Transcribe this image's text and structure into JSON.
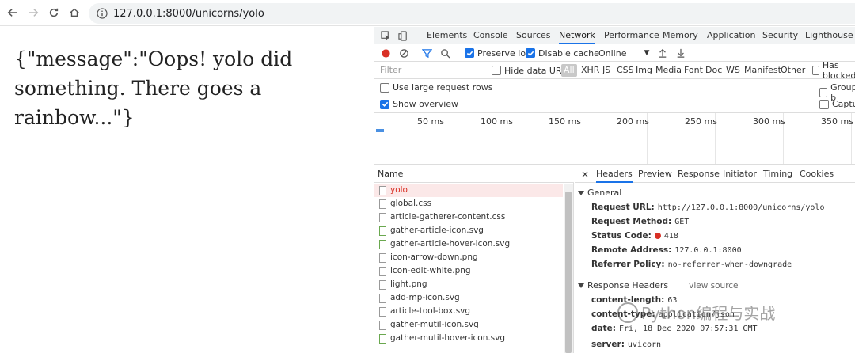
{
  "browser": {
    "url": "127.0.0.1:8000/unicorns/yolo"
  },
  "page": {
    "body_text": "{\"message\":\"Oops! yolo did something. There goes a rainbow...\"}"
  },
  "devtools": {
    "tabs": [
      "Elements",
      "Console",
      "Sources",
      "Network",
      "Performance",
      "Memory",
      "Application",
      "Security",
      "Lighthouse"
    ],
    "active_tab": "Network",
    "toolbar": {
      "preserve_log": "Preserve log",
      "disable_cache": "Disable cache",
      "throttle": "Online"
    },
    "filter": {
      "placeholder": "Filter",
      "hide_data_urls": "Hide data URLs",
      "types": [
        "All",
        "XHR",
        "JS",
        "CSS",
        "Img",
        "Media",
        "Font",
        "Doc",
        "WS",
        "Manifest",
        "Other"
      ],
      "has_blocked": "Has blocked"
    },
    "options": {
      "large_rows": "Use large request rows",
      "show_overview": "Show overview",
      "group_by": "Group b",
      "capture": "Captur"
    },
    "timeline_ticks": [
      "50 ms",
      "100 ms",
      "150 ms",
      "200 ms",
      "250 ms",
      "300 ms",
      "350 ms"
    ],
    "requests": {
      "header": "Name",
      "items": [
        "yolo",
        "global.css",
        "article-gatherer-content.css",
        "gather-article-icon.svg",
        "gather-article-hover-icon.svg",
        "icon-arrow-down.png",
        "icon-edit-white.png",
        "light.png",
        "add-mp-icon.svg",
        "article-tool-box.svg",
        "gather-mutil-icon.svg",
        "gather-mutil-hover-icon.svg"
      ]
    },
    "detail": {
      "close": "×",
      "tabs": [
        "Headers",
        "Preview",
        "Response",
        "Initiator",
        "Timing",
        "Cookies"
      ],
      "general_label": "General",
      "general": {
        "request_url_k": "Request URL:",
        "request_url_v": "http://127.0.0.1:8000/unicorns/yolo",
        "method_k": "Request Method:",
        "method_v": "GET",
        "status_k": "Status Code:",
        "status_v": "418",
        "remote_k": "Remote Address:",
        "remote_v": "127.0.0.1:8000",
        "referrer_k": "Referrer Policy:",
        "referrer_v": "no-referrer-when-downgrade"
      },
      "response_headers_label": "Response Headers",
      "view_source": "view source",
      "response": {
        "content_length_k": "content-length:",
        "content_length_v": "63",
        "content_type_k": "content-type:",
        "content_type_v": "application/json",
        "date_k": "date:",
        "date_v": "Fri, 18 Dec 2020 07:57:31 GMT",
        "server_k": "server:",
        "server_v": "uvicorn"
      }
    }
  },
  "watermark": "Python编程与实战"
}
